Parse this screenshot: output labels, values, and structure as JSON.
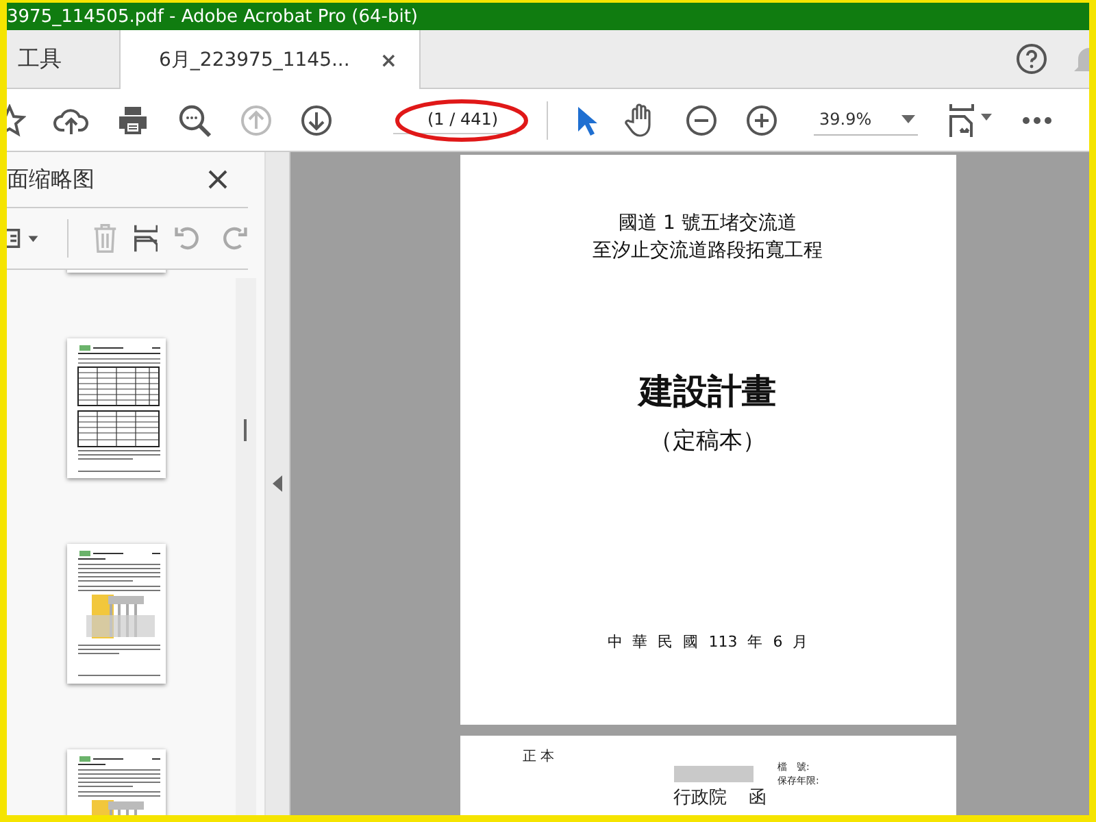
{
  "window": {
    "title": "3975_114505.pdf - Adobe Acrobat Pro (64-bit)"
  },
  "tabs": [
    {
      "label": "工具",
      "selected": false,
      "closable": false
    },
    {
      "label": "6月_223975_1145...",
      "selected": true,
      "closable": true,
      "close": "×"
    }
  ],
  "toolbar": {
    "page_indicator": "(1 / 441)",
    "highlighted": true,
    "zoom": "39.9%",
    "prev_disabled": true
  },
  "side_panel": {
    "title": "面缩略图",
    "delete_disabled": true,
    "thumbnails": [
      {
        "kind": "partial"
      },
      {
        "kind": "table"
      },
      {
        "kind": "figure"
      },
      {
        "kind": "figure"
      }
    ]
  },
  "document": {
    "pages": [
      {
        "kind": "cover",
        "lines": [
          "國道 1 號五堵交流道",
          "至汐止交流道路段拓寬工程"
        ],
        "heading": "建設計畫",
        "subheading": "（定稿本）",
        "date": "中 華 民 國 113 年 6 月"
      },
      {
        "kind": "letter",
        "copy_mark": "正 本",
        "sender": "行政院",
        "doc_type": "函",
        "file_number": "檔　號:",
        "retention": "保存年限:"
      }
    ]
  }
}
